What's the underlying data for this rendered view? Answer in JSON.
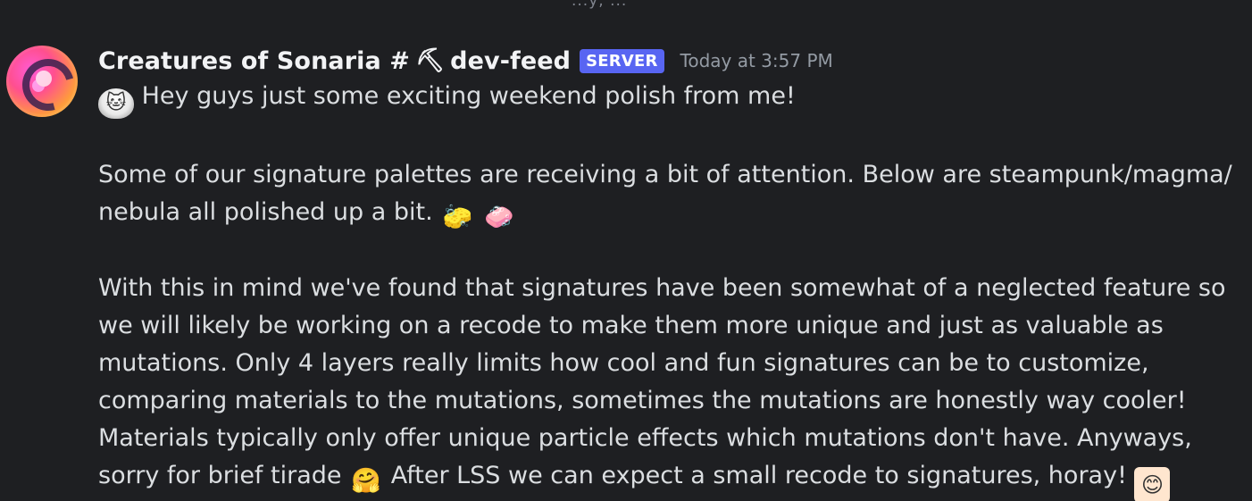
{
  "top_cut_text": "...y, ...",
  "message": {
    "author": "Creatures of Sonaria #",
    "channel_icon": "hammer-icon",
    "channel": "dev-feed",
    "badge": "SERVER",
    "timestamp": "Today at 3:57 PM",
    "lines": [
      {
        "id": "l1",
        "text": "Hey guys just some exciting weekend polish from me!"
      },
      {
        "id": "l2",
        "text": "Some of our signature palettes are receiving a bit of attention. Below are steampunk/magma/"
      },
      {
        "id": "l3",
        "text": "nebula all polished up a bit."
      },
      {
        "id": "l4",
        "text": "With this in mind we've found that signatures have been somewhat of a neglected feature so"
      },
      {
        "id": "l5",
        "text": "we will likely be working on a recode to make them more unique and just as valuable as"
      },
      {
        "id": "l6",
        "text": "mutations. Only 4 layers really limits how cool and fun signatures can be to customize,"
      },
      {
        "id": "l7",
        "text": "comparing materials to the mutations, sometimes the mutations are honestly way cooler!"
      },
      {
        "id": "l8",
        "text": "Materials typically only offer unique particle effects which mutations don't have. Anyways,"
      },
      {
        "id": "l9a",
        "text": "sorry for brief tirade"
      },
      {
        "id": "l9b",
        "text": "After LSS we can expect a small recode to signatures, horay!"
      }
    ],
    "emojis": {
      "intro": "cat-maid-emoji",
      "sponge1": "🧽",
      "sponge2": "🧼",
      "hug": "🤗",
      "end": "girl-emote"
    }
  },
  "colors": {
    "background": "#1e1f22",
    "badge": "#5865f2",
    "timestamp": "#949ba4",
    "text": "#dbdee1"
  }
}
